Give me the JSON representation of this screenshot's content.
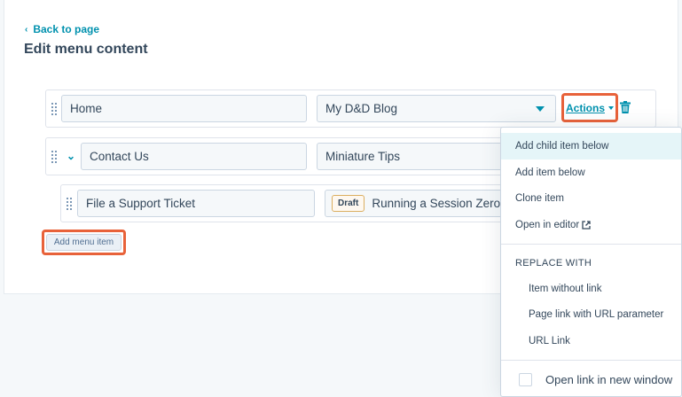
{
  "back_link": {
    "label": "Back to page",
    "icon": "chevron-left-icon"
  },
  "page_title": "Edit menu content",
  "rows": [
    {
      "label": "Home",
      "target": "My D&D Blog"
    },
    {
      "label": "Contact Us",
      "target": "Miniature Tips"
    },
    {
      "label": "File a Support Ticket",
      "badge": "Draft",
      "target": "Running a Session Zero"
    }
  ],
  "actions": {
    "label": "Actions"
  },
  "add_menu_item": "Add menu item",
  "menu": {
    "items": [
      "Add child item below",
      "Add item below",
      "Clone item",
      "Open in editor"
    ],
    "replace_header": "REPLACE WITH",
    "replace_items": [
      "Item without link",
      "Page link with URL parameter",
      "URL Link"
    ],
    "checkbox_label": "Open link in new window",
    "checkbox_checked": false
  },
  "colors": {
    "accent": "#0091ae",
    "highlight": "#e8623a",
    "text": "#33475b"
  }
}
